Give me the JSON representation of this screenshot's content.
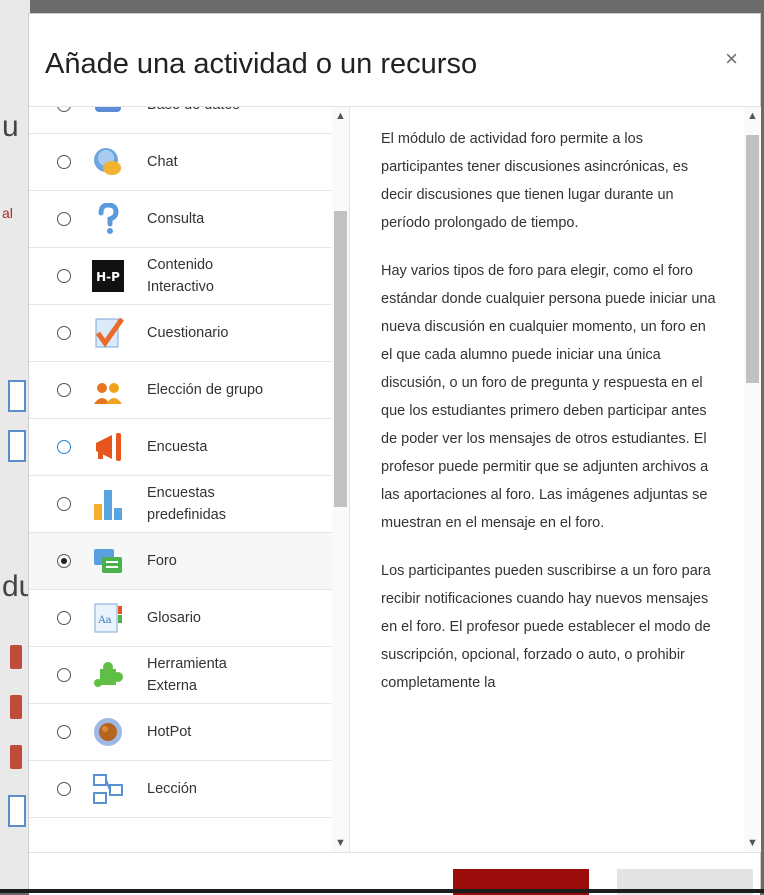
{
  "dialog": {
    "title": "Añade una actividad o un recurso",
    "close_glyph": "×"
  },
  "background": {
    "fragments": [
      "u",
      "al",
      "du"
    ]
  },
  "options": [
    {
      "label": "Base de datos",
      "icon": "database-icon",
      "selected": false
    },
    {
      "label": "Chat",
      "icon": "chat-icon",
      "selected": false
    },
    {
      "label": "Consulta",
      "icon": "question-icon",
      "selected": false
    },
    {
      "label": "Contenido\nInteractivo",
      "icon": "h5p-icon",
      "selected": false
    },
    {
      "label": "Cuestionario",
      "icon": "quiz-check-icon",
      "selected": false
    },
    {
      "label": "Elección de grupo",
      "icon": "group-choice-icon",
      "selected": false
    },
    {
      "label": "Encuesta",
      "icon": "megaphone-icon",
      "selected": false,
      "focused": true
    },
    {
      "label": "Encuestas\npredefinidas",
      "icon": "bar-chart-icon",
      "selected": false
    },
    {
      "label": "Foro",
      "icon": "forum-icon",
      "selected": true
    },
    {
      "label": "Glosario",
      "icon": "glossary-icon",
      "selected": false
    },
    {
      "label": "Herramienta\nExterna",
      "icon": "puzzle-icon",
      "selected": false
    },
    {
      "label": "HotPot",
      "icon": "hotpot-icon",
      "selected": false
    },
    {
      "label": "Lección",
      "icon": "lesson-icon",
      "selected": false
    }
  ],
  "description": {
    "paragraphs": [
      "El módulo de actividad foro permite a los participantes tener discusiones asincrónicas, es decir discusiones que tienen lugar durante un período prolongado de tiempo.",
      "Hay varios tipos de foro para elegir, como el foro estándar donde cualquier persona puede iniciar una nueva discusión en cualquier momento, un foro en el que cada alumno puede iniciar una única discusión, o un foro de pregunta y respuesta en el que los estudiantes primero deben participar antes de poder ver los mensajes de otros estudiantes. El profesor puede permitir que se adjunten archivos a las aportaciones al foro. Las imágenes adjuntas se muestran en el mensaje en el foro.",
      "Los participantes pueden suscribirse a un foro para recibir notificaciones cuando hay nuevos mensajes en el foro. El profesor puede establecer el modo de suscripción, opcional, forzado o auto, o prohibir completamente la"
    ]
  },
  "colors": {
    "primary_button": "#9a0c0c",
    "secondary_button": "#e4e4e4",
    "radio_focus": "#2b7fd1"
  }
}
